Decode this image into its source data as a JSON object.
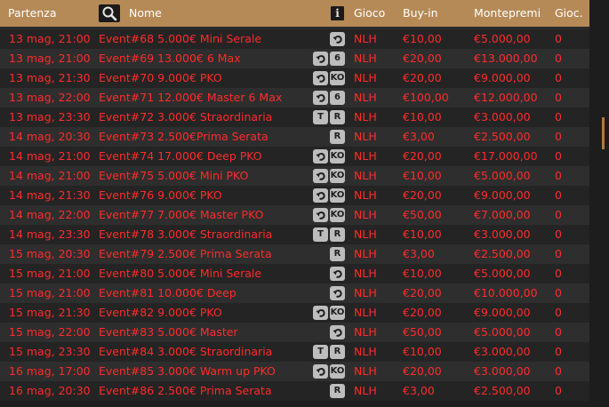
{
  "header": {
    "col_start": "Partenza",
    "col_name": "Nome",
    "info_glyph": "i",
    "col_game": "Gioco",
    "col_buyin": "Buy-in",
    "col_prize": "Montepremi",
    "col_players": "Gioc.",
    "search_icon": "magnifier-icon",
    "info_icon": "info-icon"
  },
  "colors": {
    "header_bg": "#b68a57",
    "row_text": "#ff2b2b",
    "row_odd": "#242424",
    "row_even": "#2e2e2e",
    "badge_bg": "#bdbdbd",
    "scroll_thumb": "#b5773e"
  },
  "tournaments": [
    {
      "start": "13 mag, 21:00",
      "name": "Event#68 5.000€ Mini Serale",
      "badges": [
        "rebuy"
      ],
      "game": "NLH",
      "buyin": "€10,00",
      "prize": "€5.000,00",
      "players": "0"
    },
    {
      "start": "13 mag, 21:00",
      "name": "Event#69 13.000€ 6 Max",
      "badges": [
        "rebuy",
        "6"
      ],
      "game": "NLH",
      "buyin": "€20,00",
      "prize": "€13.000,00",
      "players": "0"
    },
    {
      "start": "13 mag, 21:30",
      "name": "Event#70 9.000€ PKO",
      "badges": [
        "rebuy",
        "KO"
      ],
      "game": "NLH",
      "buyin": "€20,00",
      "prize": "€9.000,00",
      "players": "0"
    },
    {
      "start": "13 mag, 22:00",
      "name": "Event#71 12.000€ Master 6 Max",
      "badges": [
        "rebuy",
        "6"
      ],
      "game": "NLH",
      "buyin": "€100,00",
      "prize": "€12.000,00",
      "players": "0"
    },
    {
      "start": "13 mag, 23:30",
      "name": "Event#72 3.000€ Straordinaria",
      "badges": [
        "T",
        "R"
      ],
      "game": "NLH",
      "buyin": "€10,00",
      "prize": "€3.000,00",
      "players": "0"
    },
    {
      "start": "14 mag, 20:30",
      "name": "Event#73 2.500€Prima Serata",
      "badges": [
        "R"
      ],
      "game": "NLH",
      "buyin": "€3,00",
      "prize": "€2.500,00",
      "players": "0"
    },
    {
      "start": "14 mag, 21:00",
      "name": "Event#74 17.000€ Deep PKO",
      "badges": [
        "rebuy",
        "KO"
      ],
      "game": "NLH",
      "buyin": "€20,00",
      "prize": "€17.000,00",
      "players": "0"
    },
    {
      "start": "14 mag, 21:00",
      "name": "Event#75 5.000€ Mini PKO",
      "badges": [
        "rebuy",
        "KO"
      ],
      "game": "NLH",
      "buyin": "€10,00",
      "prize": "€5.000,00",
      "players": "0"
    },
    {
      "start": "14 mag, 21:30",
      "name": "Event#76 9.000€ PKO",
      "badges": [
        "rebuy",
        "KO"
      ],
      "game": "NLH",
      "buyin": "€20,00",
      "prize": "€9.000,00",
      "players": "0"
    },
    {
      "start": "14 mag, 22:00",
      "name": "Event#77 7.000€ Master PKO",
      "badges": [
        "rebuy",
        "KO"
      ],
      "game": "NLH",
      "buyin": "€50,00",
      "prize": "€7.000,00",
      "players": "0"
    },
    {
      "start": "14 mag, 23:30",
      "name": "Event#78 3.000€ Straordinaria",
      "badges": [
        "T",
        "R"
      ],
      "game": "NLH",
      "buyin": "€10,00",
      "prize": "€3.000,00",
      "players": "0"
    },
    {
      "start": "15 mag, 20:30",
      "name": "Event#79 2.500€ Prima Serata",
      "badges": [
        "R"
      ],
      "game": "NLH",
      "buyin": "€3,00",
      "prize": "€2.500,00",
      "players": "0"
    },
    {
      "start": "15 mag, 21:00",
      "name": "Event#80 5.000€ Mini Serale",
      "badges": [
        "rebuy"
      ],
      "game": "NLH",
      "buyin": "€10,00",
      "prize": "€5.000,00",
      "players": "0"
    },
    {
      "start": "15 mag, 21:00",
      "name": "Event#81 10.000€ Deep",
      "badges": [
        "rebuy"
      ],
      "game": "NLH",
      "buyin": "€20,00",
      "prize": "€10.000,00",
      "players": "0"
    },
    {
      "start": "15 mag, 21:30",
      "name": "Event#82 9.000€ PKO",
      "badges": [
        "rebuy",
        "KO"
      ],
      "game": "NLH",
      "buyin": "€20,00",
      "prize": "€9.000,00",
      "players": "0"
    },
    {
      "start": "15 mag, 22:00",
      "name": "Event#83 5.000€ Master",
      "badges": [
        "rebuy"
      ],
      "game": "NLH",
      "buyin": "€50,00",
      "prize": "€5.000,00",
      "players": "0"
    },
    {
      "start": "15 mag, 23:30",
      "name": "Event#84 3.000€ Straordinaria",
      "badges": [
        "T",
        "R"
      ],
      "game": "NLH",
      "buyin": "€10,00",
      "prize": "€3.000,00",
      "players": "0"
    },
    {
      "start": "16 mag, 17:00",
      "name": "Event#85 3.000€ Warm up PKO",
      "badges": [
        "rebuy",
        "KO"
      ],
      "game": "NLH",
      "buyin": "€20,00",
      "prize": "€3.000,00",
      "players": "0"
    },
    {
      "start": "16 mag, 20:30",
      "name": "Event#86 2.500€ Prima Serata",
      "badges": [
        "R"
      ],
      "game": "NLH",
      "buyin": "€3,00",
      "prize": "€2.500,00",
      "players": "0"
    }
  ]
}
